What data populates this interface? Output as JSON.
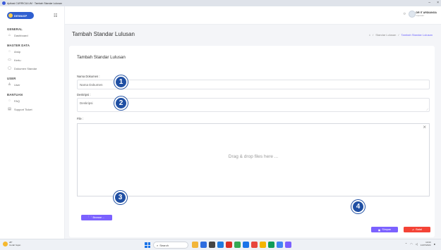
{
  "browser": {
    "tab_title": "Apikasi CURRICULUM · Tambah Standar Lulusan"
  },
  "sidebar": {
    "logo_text": "DEWASP",
    "sections": [
      {
        "title": "GENERAL",
        "items": [
          {
            "label": "Dashboard",
            "icon": "home-icon"
          }
        ]
      },
      {
        "title": "MASTER DATA",
        "items": [
          {
            "label": "Arsip",
            "icon": "archive-icon"
          },
          {
            "label": "Kertu",
            "icon": "card-icon"
          },
          {
            "label": "Dokumen Standar",
            "icon": "document-icon"
          }
        ]
      },
      {
        "title": "USER",
        "items": [
          {
            "label": "User",
            "icon": "user-icon"
          }
        ]
      },
      {
        "title": "BANTUAN",
        "items": [
          {
            "label": "FAQ",
            "icon": "help-icon"
          },
          {
            "label": "Support Ticket",
            "icon": "ticket-icon"
          }
        ]
      }
    ]
  },
  "header": {
    "user_name": "DR IT ARDIANGA",
    "user_role": "Operator"
  },
  "page": {
    "title": "Tambah Standar Lulusan",
    "breadcrumb": [
      "Standar Lulusan",
      "Tambah Standar Lulusan"
    ]
  },
  "form": {
    "card_title": "Tambah Standar Lulusan",
    "nama_label": "Nama Dokumen :",
    "nama_placeholder": "Nama Dokumen",
    "deskripsi_label": "Deskripsi :",
    "deskripsi_placeholder": "Deskripsi",
    "file_label": "File :",
    "dropzone_text": "Drag & drop files here ...",
    "browse_label": "Browse ...",
    "save_label": "Simpan",
    "cancel_label": "Batal"
  },
  "markers": [
    "1",
    "2",
    "3",
    "4"
  ],
  "taskbar": {
    "weather_temp": "28°",
    "weather_desc": "Cerah hujan",
    "search_label": "Search",
    "clock_time": "13:03",
    "clock_date": "11/07/2024"
  },
  "colors": {
    "accent": "#7b61ff",
    "danger": "#f44336",
    "marker": "#1f4fa3",
    "logo": "#2f5fd0"
  }
}
